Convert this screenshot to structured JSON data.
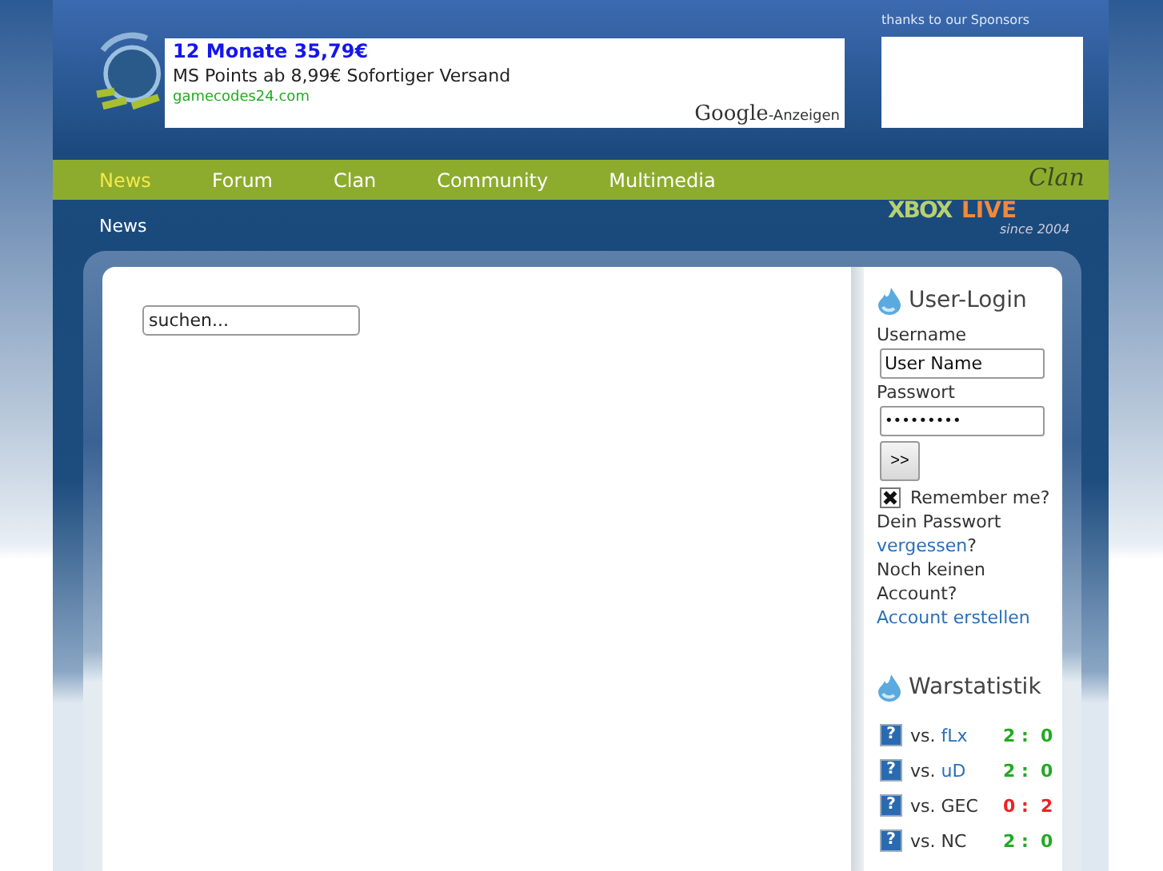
{
  "ad": {
    "headline": "12 Monate 35,79€",
    "text": "MS Points ab 8,99€ Sofortiger Versand",
    "url": "gamecodes24.com",
    "brand": "Google",
    "brand_suffix": "-Anzeigen"
  },
  "sponsors": {
    "label": "thanks to our Sponsors"
  },
  "nav": [
    {
      "label": "News",
      "selected": true
    },
    {
      "label": "Forum",
      "selected": false
    },
    {
      "label": "Clan",
      "selected": false
    },
    {
      "label": "Community",
      "selected": false
    },
    {
      "label": "Multimedia",
      "selected": false
    }
  ],
  "clan_logo": {
    "xbox": "XBOX",
    "live": "LIVE",
    "clan": "Clan",
    "since": "since 2004"
  },
  "breadcrumb": "News",
  "search": {
    "placeholder": "suchen..."
  },
  "login": {
    "title": "User-Login",
    "username_label": "Username",
    "username": "User Name",
    "password_label": "Passwort",
    "password": "•••••••••",
    "submit": ">>",
    "remember": {
      "label": "Remember me?",
      "checked": true
    },
    "forgot_text": "Dein Passwort",
    "forgot_link": "vergessen",
    "forgot_end": "?",
    "register_text": "Noch keinen Account?",
    "register_link": "Account erstellen"
  },
  "warstats": {
    "title": "Warstatistik",
    "rows": [
      {
        "icon": "?",
        "vs": "vs.",
        "opponent": "fLx",
        "link": true,
        "score": "2 :  0",
        "color": "#22aa22"
      },
      {
        "icon": "?",
        "vs": "vs.",
        "opponent": "uD",
        "link": true,
        "score": "2 :  0",
        "color": "#22aa22"
      },
      {
        "icon": "?",
        "vs": "vs.",
        "opponent": "GEC",
        "link": false,
        "score": "0 :  2",
        "color": "#ee2222"
      },
      {
        "icon": "?",
        "vs": "vs.",
        "opponent": "NC",
        "link": false,
        "score": "2 :  0",
        "color": "#22aa22"
      }
    ]
  }
}
